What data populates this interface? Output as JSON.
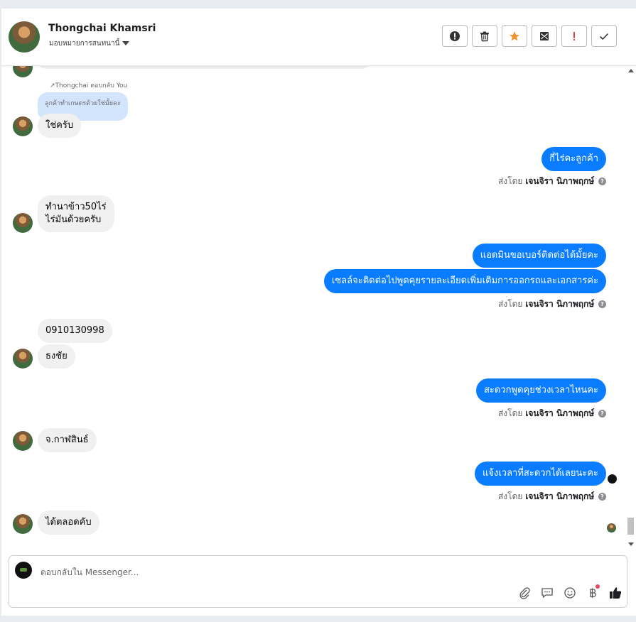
{
  "header": {
    "name": "Thongchai Khamsri",
    "assign_label": "มอบหมายการสนทนานี้"
  },
  "toolbar_icons": [
    "alert-icon",
    "trash-icon",
    "star-icon",
    "mail-icon",
    "important-icon",
    "check-icon"
  ],
  "messages": {
    "reply_note": "Thongchai ตอบกลับ You",
    "reply_quote": "ลูกค้าทำเกษตรด้วยใช่มั้ยคะ",
    "in_1": "ใช่ครับ",
    "out_1": "กี่ไร่คะลูกค้า",
    "in_2_line1": "ทำนาข้าว50ไร่",
    "in_2_line2": "ไร่มันด้วยครับ",
    "out_2": "แอดมินขอเบอร์ติดต่อได้มั้ยคะ",
    "out_3": "เซลล์จะติดต่อไปพูดคุยรายละเอียดเพิ่มเติมการออกรถและเอกสารค่ะ",
    "in_3": "0910130998",
    "in_4": "ธงชัย",
    "out_4": "สะดวกพูดคุยช่วงเวลาไหนคะ",
    "in_5": "จ.กาฬสินธ์",
    "out_5": "แจ้งเวลาที่สะดวกได้เลยนะคะ",
    "in_6": "ได้ตลอดคับ",
    "sent_by_prefix": "ส่งโดย",
    "sent_by_name": "เจนจิรา นิภาพฤกษ์",
    "help_mark": "?"
  },
  "composer": {
    "placeholder": "ตอบกลับใน Messenger..."
  },
  "colors": {
    "outgoing_bubble": "#0a7cff",
    "incoming_bubble": "#f0f0f0",
    "reply_quote_bg": "#d3e4fd",
    "star": "#f0932b",
    "important": "#e23b3b"
  }
}
